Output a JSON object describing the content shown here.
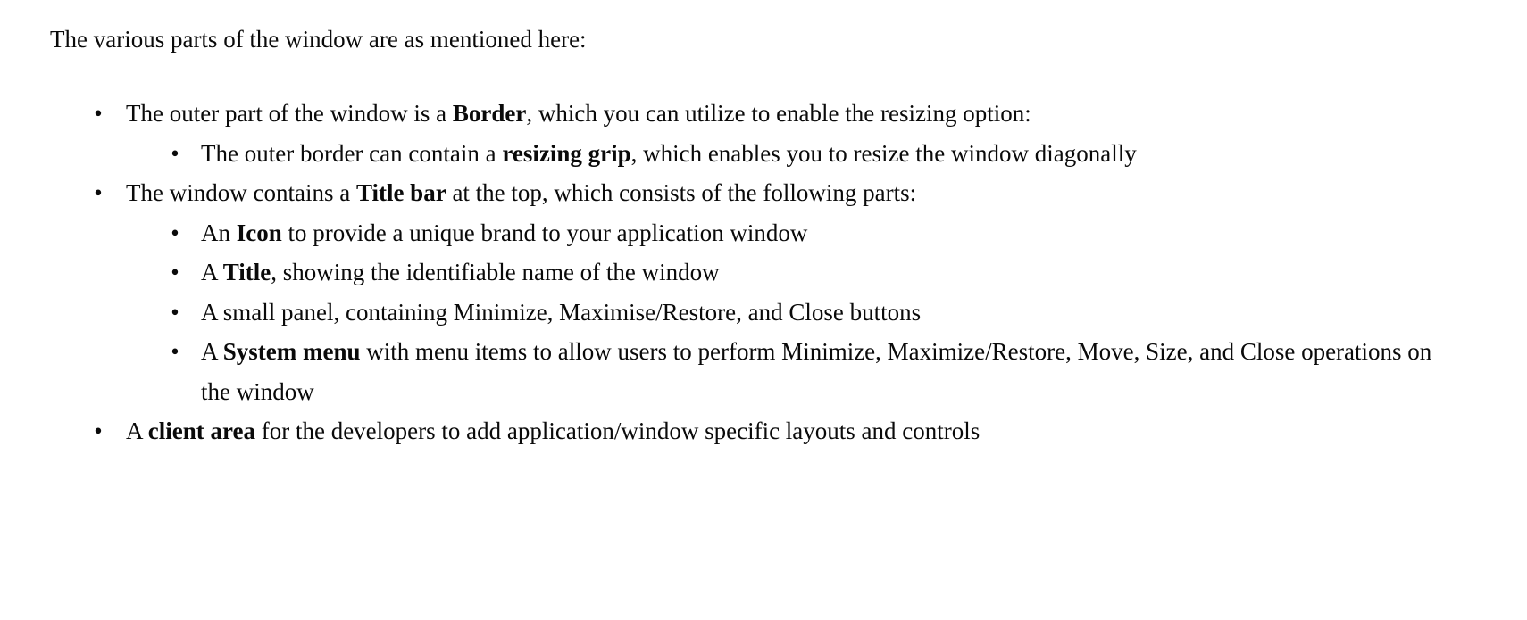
{
  "document": {
    "intro": "The various parts of the window are as mentioned here:",
    "bullet_glyph": "•",
    "text_color": "#0a0a0a",
    "background_color": "#ffffff",
    "items": [
      {
        "level": 1,
        "segments": [
          {
            "text": "The outer part of the window is a ",
            "bold": false
          },
          {
            "text": "Border",
            "bold": true
          },
          {
            "text": ", which you can utilize to enable the resizing option:",
            "bold": false
          }
        ],
        "children": [
          {
            "level": 2,
            "segments": [
              {
                "text": "The outer border can contain a ",
                "bold": false
              },
              {
                "text": "resizing grip",
                "bold": true
              },
              {
                "text": ", which enables you to resize the window diagonally",
                "bold": false
              }
            ]
          }
        ]
      },
      {
        "level": 1,
        "segments": [
          {
            "text": "The window contains a ",
            "bold": false
          },
          {
            "text": "Title bar",
            "bold": true
          },
          {
            "text": " at the top, which consists of the following parts:",
            "bold": false
          }
        ],
        "children": [
          {
            "level": 2,
            "segments": [
              {
                "text": "An ",
                "bold": false
              },
              {
                "text": "Icon",
                "bold": true
              },
              {
                "text": " to provide a unique brand to your application window",
                "bold": false
              }
            ]
          },
          {
            "level": 2,
            "segments": [
              {
                "text": "A ",
                "bold": false
              },
              {
                "text": "Title",
                "bold": true
              },
              {
                "text": ", showing the identifiable name of the window",
                "bold": false
              }
            ]
          },
          {
            "level": 2,
            "segments": [
              {
                "text": "A small panel, containing Minimize, Maximise/Restore, and Close buttons",
                "bold": false
              }
            ]
          },
          {
            "level": 2,
            "segments": [
              {
                "text": "A ",
                "bold": false
              },
              {
                "text": "System menu",
                "bold": true
              },
              {
                "text": " with menu items to allow users to perform Minimize, Maximize/Restore, Move, Size, and Close operations on the window",
                "bold": false
              }
            ]
          }
        ]
      },
      {
        "level": 1,
        "segments": [
          {
            "text": "A ",
            "bold": false
          },
          {
            "text": "client area",
            "bold": true
          },
          {
            "text": " for the developers to add application/window specific layouts and controls",
            "bold": false
          }
        ]
      }
    ]
  }
}
